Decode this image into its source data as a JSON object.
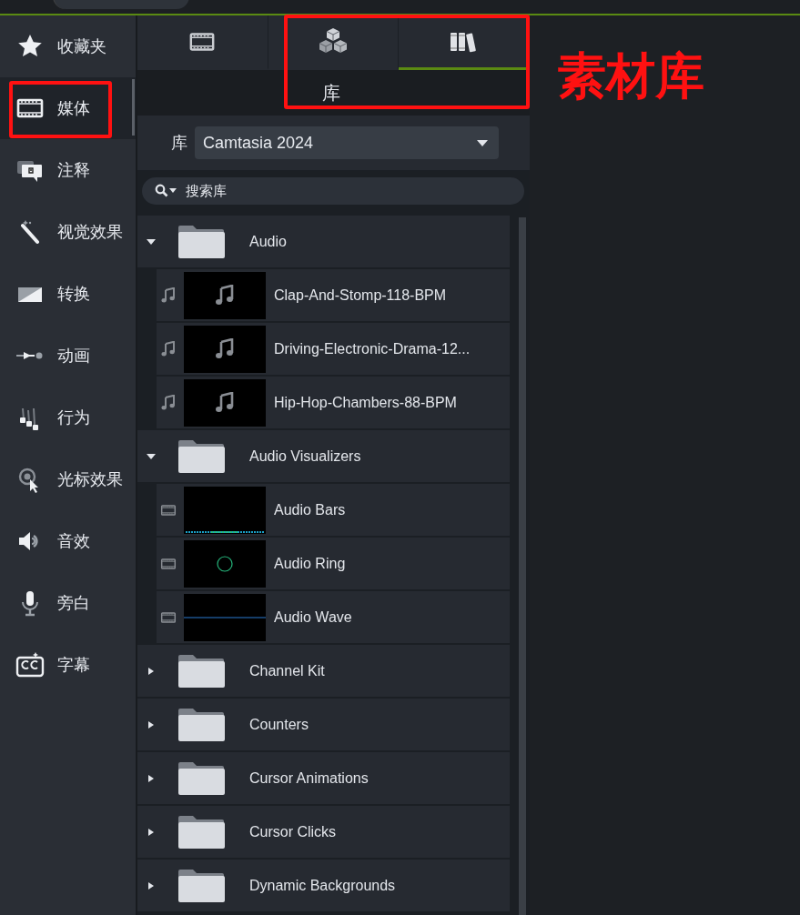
{
  "sidebar": {
    "items": [
      {
        "label": "收藏夹",
        "selected": false
      },
      {
        "label": "媒体",
        "selected": true
      },
      {
        "label": "注释",
        "selected": false
      },
      {
        "label": "视觉效果",
        "selected": false
      },
      {
        "label": "转换",
        "selected": false
      },
      {
        "label": "动画",
        "selected": false
      },
      {
        "label": "行为",
        "selected": false
      },
      {
        "label": "光标效果",
        "selected": false
      },
      {
        "label": "音效",
        "selected": false
      },
      {
        "label": "旁白",
        "selected": false
      },
      {
        "label": "字幕",
        "selected": false
      }
    ]
  },
  "tabs": [
    {
      "selected": false
    },
    {
      "selected": false
    },
    {
      "selected": true
    }
  ],
  "tooltip": "库",
  "library": {
    "label": "库",
    "value": "Camtasia 2024"
  },
  "search": {
    "placeholder": "搜索库"
  },
  "folders": [
    {
      "name": "Audio",
      "expanded": true,
      "children": [
        {
          "name": "Clap-And-Stomp-118-BPM",
          "kind": "audio"
        },
        {
          "name": "Driving-Electronic-Drama-12...",
          "kind": "audio"
        },
        {
          "name": "Hip-Hop-Chambers-88-BPM",
          "kind": "audio"
        }
      ]
    },
    {
      "name": "Audio Visualizers",
      "expanded": true,
      "children": [
        {
          "name": "Audio Bars",
          "kind": "bars"
        },
        {
          "name": "Audio Ring",
          "kind": "ring"
        },
        {
          "name": "Audio Wave",
          "kind": "wave"
        }
      ]
    },
    {
      "name": "Channel Kit",
      "expanded": false
    },
    {
      "name": "Counters",
      "expanded": false
    },
    {
      "name": "Cursor Animations",
      "expanded": false
    },
    {
      "name": "Cursor Clicks",
      "expanded": false
    },
    {
      "name": "Dynamic Backgrounds",
      "expanded": false
    }
  ],
  "annotation": {
    "text": "素材库"
  }
}
